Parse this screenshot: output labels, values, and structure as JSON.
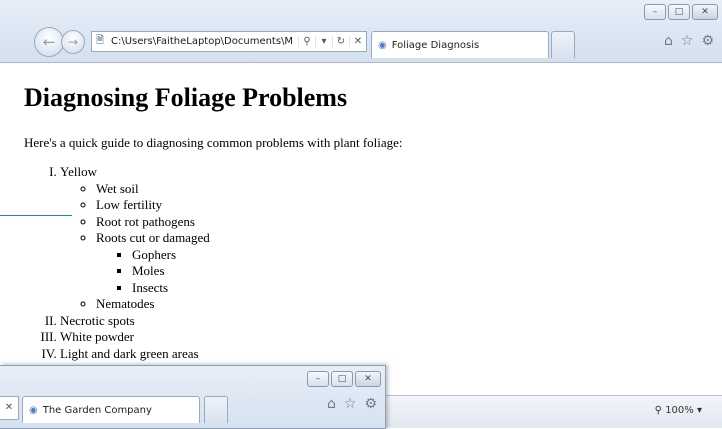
{
  "browser": {
    "address": "C:\\Users\\FaitheLaptop\\Documents\\M",
    "tab_title": "Foliage Diagnosis",
    "window_buttons": [
      "–",
      "□",
      "✕"
    ],
    "nav_icons": [
      "back-icon",
      "forward-icon",
      "home-icon",
      "favorites-icon",
      "tools-icon"
    ],
    "zoom": "100%"
  },
  "page": {
    "title": "Diagnosing Foliage Problems",
    "intro": "Here's a quick guide to diagnosing common problems with plant foliage:",
    "problems": [
      {
        "label": "Yellow",
        "causes": [
          "Wet soil",
          "Low fertility",
          "Root rot pathogens",
          "Roots cut or damaged",
          "Nematodes"
        ],
        "root_damage_causes": [
          "Gophers",
          "Moles",
          "Insects"
        ]
      },
      {
        "label": "Necrotic spots"
      },
      {
        "label": "White powder"
      },
      {
        "label": "Light and dark green areas"
      }
    ]
  },
  "second_window": {
    "tab_title": "The Garden Company"
  },
  "colors": {
    "callout_line": "#1c84c6",
    "chrome_bg": "#dbe6f3"
  }
}
